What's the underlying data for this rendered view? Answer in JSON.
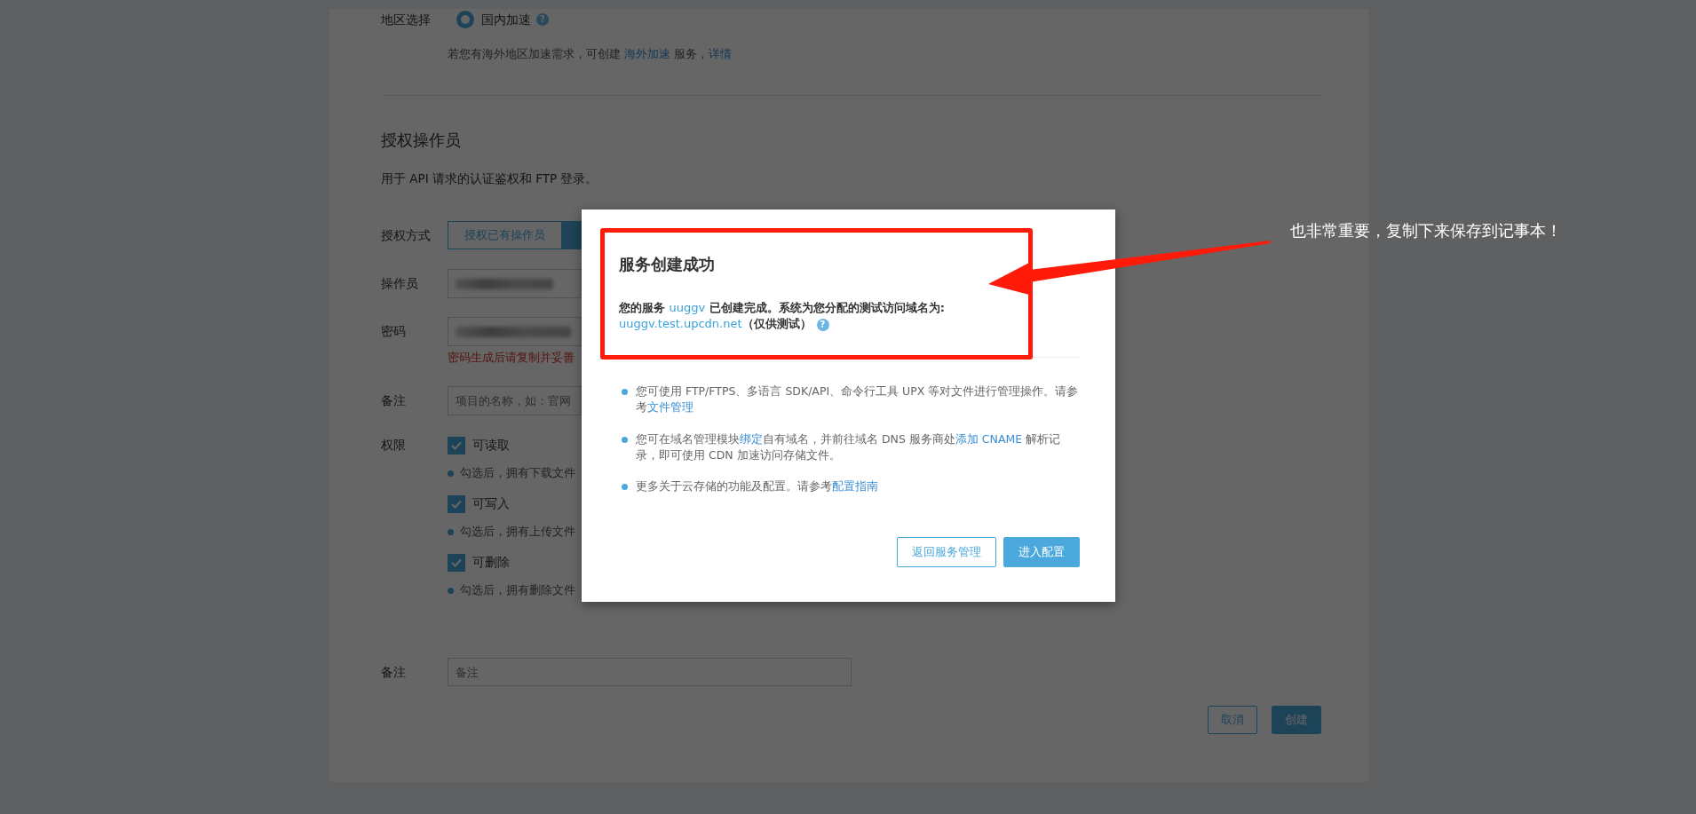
{
  "region": {
    "label": "地区选择",
    "options": [
      {
        "label": "国内加速",
        "selected": true,
        "help": "?"
      }
    ],
    "hint": [
      {
        "kind": "text",
        "text": "若您有海外地区加速需求，可创建 "
      },
      {
        "kind": "link",
        "text": "海外加速"
      },
      {
        "kind": "text",
        "text": " 服务，"
      },
      {
        "kind": "link",
        "text": "详情"
      }
    ]
  },
  "operator_section": {
    "title": "授权操作员",
    "description": "用于 API 请求的认证鉴权和 FTP 登录。",
    "fields": [
      {
        "kind": "toggle",
        "label": "授权方式",
        "options": [
          {
            "label": "授权已有操作员",
            "selected": false
          },
          {
            "selected": true
          }
        ]
      },
      {
        "kind": "redacted",
        "label": "操作员"
      },
      {
        "kind": "redacted",
        "label": "密码",
        "warning": "密码生成后请复制并妥善"
      },
      {
        "kind": "input",
        "label": "备注",
        "placeholder": "项目的名称，如：官网"
      },
      {
        "kind": "permissions",
        "label": "权限",
        "items": [
          {
            "label": "可读取",
            "checked": true,
            "hint": "勾选后，拥有下载文件"
          },
          {
            "label": "可写入",
            "checked": true,
            "hint": "勾选后，拥有上传文件"
          },
          {
            "label": "可删除",
            "checked": true,
            "hint": "勾选后，拥有删除文件"
          }
        ]
      }
    ]
  },
  "note": {
    "label": "备注",
    "placeholder": "备注"
  },
  "actions": [
    {
      "label": "取消",
      "kind": "secondary"
    },
    {
      "label": "创建",
      "kind": "primary"
    }
  ],
  "dialog": {
    "title": "服务创建成功",
    "message": [
      [
        {
          "kind": "text",
          "text": "您的服务 "
        },
        {
          "kind": "link",
          "text": "uuggv"
        },
        {
          "kind": "text",
          "text": " 已创建完成。系统为您分配的测试访问域名为:"
        }
      ],
      [
        {
          "kind": "link",
          "text": "uuggv.test.upcdn.net"
        },
        {
          "kind": "text",
          "text": "（仅供测试）"
        },
        {
          "kind": "help",
          "text": "?"
        }
      ]
    ],
    "tips": [
      [
        {
          "kind": "text",
          "text": "您可使用 FTP/FTPS、多语言 SDK/API、命令行工具 UPX 等对文件进行管理操作。请参考"
        },
        {
          "kind": "link",
          "text": "文件管理"
        }
      ],
      [
        {
          "kind": "text",
          "text": "您可在域名管理模块"
        },
        {
          "kind": "link",
          "text": "绑定"
        },
        {
          "kind": "text",
          "text": "自有域名，并前往域名 DNS 服务商处"
        },
        {
          "kind": "link",
          "text": "添加 CNAME"
        },
        {
          "kind": "text",
          "text": " 解析记录，即可使用 CDN 加速访问存储文件。"
        }
      ],
      [
        {
          "kind": "text",
          "text": "更多关于云存储的功能及配置。请参考"
        },
        {
          "kind": "link",
          "text": "配置指南"
        }
      ]
    ],
    "buttons": [
      {
        "label": "返回服务管理",
        "kind": "secondary"
      },
      {
        "label": "进入配置",
        "kind": "primary"
      }
    ]
  },
  "annotation": {
    "text": "也非常重要，复制下来保存到记事本！"
  }
}
